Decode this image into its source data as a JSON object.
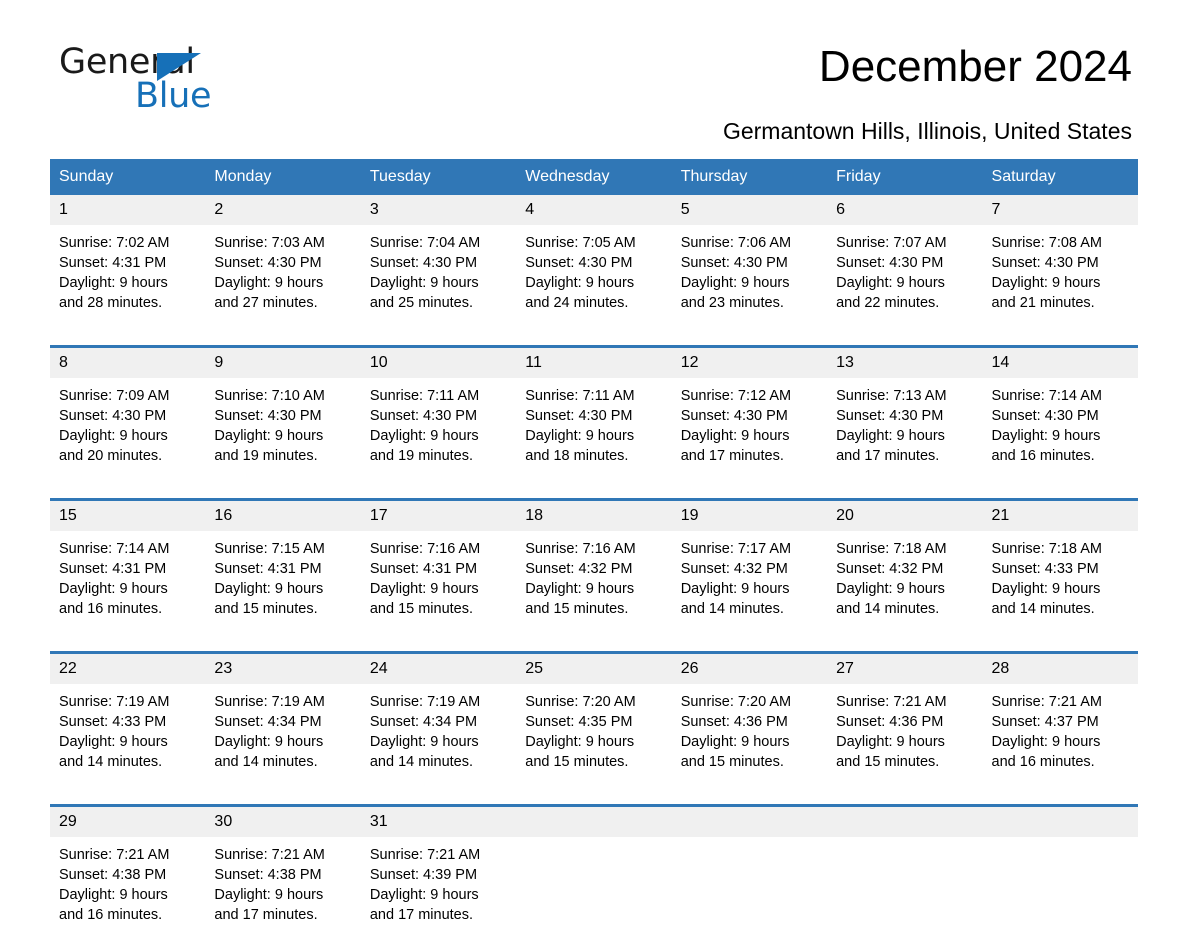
{
  "brand": {
    "name_part1": "General",
    "name_part2": "Blue",
    "accent_color": "#1670b8"
  },
  "header": {
    "title": "December 2024",
    "location": "Germantown Hills, Illinois, United States"
  },
  "calendar": {
    "header_color": "#3077b6",
    "daynum_background": "#f0f0f0",
    "weekdays": [
      "Sunday",
      "Monday",
      "Tuesday",
      "Wednesday",
      "Thursday",
      "Friday",
      "Saturday"
    ],
    "weeks": [
      [
        {
          "day": "1",
          "sunrise": "Sunrise: 7:02 AM",
          "sunset": "Sunset: 4:31 PM",
          "daylight_line1": "Daylight: 9 hours",
          "daylight_line2": "and 28 minutes."
        },
        {
          "day": "2",
          "sunrise": "Sunrise: 7:03 AM",
          "sunset": "Sunset: 4:30 PM",
          "daylight_line1": "Daylight: 9 hours",
          "daylight_line2": "and 27 minutes."
        },
        {
          "day": "3",
          "sunrise": "Sunrise: 7:04 AM",
          "sunset": "Sunset: 4:30 PM",
          "daylight_line1": "Daylight: 9 hours",
          "daylight_line2": "and 25 minutes."
        },
        {
          "day": "4",
          "sunrise": "Sunrise: 7:05 AM",
          "sunset": "Sunset: 4:30 PM",
          "daylight_line1": "Daylight: 9 hours",
          "daylight_line2": "and 24 minutes."
        },
        {
          "day": "5",
          "sunrise": "Sunrise: 7:06 AM",
          "sunset": "Sunset: 4:30 PM",
          "daylight_line1": "Daylight: 9 hours",
          "daylight_line2": "and 23 minutes."
        },
        {
          "day": "6",
          "sunrise": "Sunrise: 7:07 AM",
          "sunset": "Sunset: 4:30 PM",
          "daylight_line1": "Daylight: 9 hours",
          "daylight_line2": "and 22 minutes."
        },
        {
          "day": "7",
          "sunrise": "Sunrise: 7:08 AM",
          "sunset": "Sunset: 4:30 PM",
          "daylight_line1": "Daylight: 9 hours",
          "daylight_line2": "and 21 minutes."
        }
      ],
      [
        {
          "day": "8",
          "sunrise": "Sunrise: 7:09 AM",
          "sunset": "Sunset: 4:30 PM",
          "daylight_line1": "Daylight: 9 hours",
          "daylight_line2": "and 20 minutes."
        },
        {
          "day": "9",
          "sunrise": "Sunrise: 7:10 AM",
          "sunset": "Sunset: 4:30 PM",
          "daylight_line1": "Daylight: 9 hours",
          "daylight_line2": "and 19 minutes."
        },
        {
          "day": "10",
          "sunrise": "Sunrise: 7:11 AM",
          "sunset": "Sunset: 4:30 PM",
          "daylight_line1": "Daylight: 9 hours",
          "daylight_line2": "and 19 minutes."
        },
        {
          "day": "11",
          "sunrise": "Sunrise: 7:11 AM",
          "sunset": "Sunset: 4:30 PM",
          "daylight_line1": "Daylight: 9 hours",
          "daylight_line2": "and 18 minutes."
        },
        {
          "day": "12",
          "sunrise": "Sunrise: 7:12 AM",
          "sunset": "Sunset: 4:30 PM",
          "daylight_line1": "Daylight: 9 hours",
          "daylight_line2": "and 17 minutes."
        },
        {
          "day": "13",
          "sunrise": "Sunrise: 7:13 AM",
          "sunset": "Sunset: 4:30 PM",
          "daylight_line1": "Daylight: 9 hours",
          "daylight_line2": "and 17 minutes."
        },
        {
          "day": "14",
          "sunrise": "Sunrise: 7:14 AM",
          "sunset": "Sunset: 4:30 PM",
          "daylight_line1": "Daylight: 9 hours",
          "daylight_line2": "and 16 minutes."
        }
      ],
      [
        {
          "day": "15",
          "sunrise": "Sunrise: 7:14 AM",
          "sunset": "Sunset: 4:31 PM",
          "daylight_line1": "Daylight: 9 hours",
          "daylight_line2": "and 16 minutes."
        },
        {
          "day": "16",
          "sunrise": "Sunrise: 7:15 AM",
          "sunset": "Sunset: 4:31 PM",
          "daylight_line1": "Daylight: 9 hours",
          "daylight_line2": "and 15 minutes."
        },
        {
          "day": "17",
          "sunrise": "Sunrise: 7:16 AM",
          "sunset": "Sunset: 4:31 PM",
          "daylight_line1": "Daylight: 9 hours",
          "daylight_line2": "and 15 minutes."
        },
        {
          "day": "18",
          "sunrise": "Sunrise: 7:16 AM",
          "sunset": "Sunset: 4:32 PM",
          "daylight_line1": "Daylight: 9 hours",
          "daylight_line2": "and 15 minutes."
        },
        {
          "day": "19",
          "sunrise": "Sunrise: 7:17 AM",
          "sunset": "Sunset: 4:32 PM",
          "daylight_line1": "Daylight: 9 hours",
          "daylight_line2": "and 14 minutes."
        },
        {
          "day": "20",
          "sunrise": "Sunrise: 7:18 AM",
          "sunset": "Sunset: 4:32 PM",
          "daylight_line1": "Daylight: 9 hours",
          "daylight_line2": "and 14 minutes."
        },
        {
          "day": "21",
          "sunrise": "Sunrise: 7:18 AM",
          "sunset": "Sunset: 4:33 PM",
          "daylight_line1": "Daylight: 9 hours",
          "daylight_line2": "and 14 minutes."
        }
      ],
      [
        {
          "day": "22",
          "sunrise": "Sunrise: 7:19 AM",
          "sunset": "Sunset: 4:33 PM",
          "daylight_line1": "Daylight: 9 hours",
          "daylight_line2": "and 14 minutes."
        },
        {
          "day": "23",
          "sunrise": "Sunrise: 7:19 AM",
          "sunset": "Sunset: 4:34 PM",
          "daylight_line1": "Daylight: 9 hours",
          "daylight_line2": "and 14 minutes."
        },
        {
          "day": "24",
          "sunrise": "Sunrise: 7:19 AM",
          "sunset": "Sunset: 4:34 PM",
          "daylight_line1": "Daylight: 9 hours",
          "daylight_line2": "and 14 minutes."
        },
        {
          "day": "25",
          "sunrise": "Sunrise: 7:20 AM",
          "sunset": "Sunset: 4:35 PM",
          "daylight_line1": "Daylight: 9 hours",
          "daylight_line2": "and 15 minutes."
        },
        {
          "day": "26",
          "sunrise": "Sunrise: 7:20 AM",
          "sunset": "Sunset: 4:36 PM",
          "daylight_line1": "Daylight: 9 hours",
          "daylight_line2": "and 15 minutes."
        },
        {
          "day": "27",
          "sunrise": "Sunrise: 7:21 AM",
          "sunset": "Sunset: 4:36 PM",
          "daylight_line1": "Daylight: 9 hours",
          "daylight_line2": "and 15 minutes."
        },
        {
          "day": "28",
          "sunrise": "Sunrise: 7:21 AM",
          "sunset": "Sunset: 4:37 PM",
          "daylight_line1": "Daylight: 9 hours",
          "daylight_line2": "and 16 minutes."
        }
      ],
      [
        {
          "day": "29",
          "sunrise": "Sunrise: 7:21 AM",
          "sunset": "Sunset: 4:38 PM",
          "daylight_line1": "Daylight: 9 hours",
          "daylight_line2": "and 16 minutes."
        },
        {
          "day": "30",
          "sunrise": "Sunrise: 7:21 AM",
          "sunset": "Sunset: 4:38 PM",
          "daylight_line1": "Daylight: 9 hours",
          "daylight_line2": "and 17 minutes."
        },
        {
          "day": "31",
          "sunrise": "Sunrise: 7:21 AM",
          "sunset": "Sunset: 4:39 PM",
          "daylight_line1": "Daylight: 9 hours",
          "daylight_line2": "and 17 minutes."
        },
        {
          "day": "",
          "sunrise": "",
          "sunset": "",
          "daylight_line1": "",
          "daylight_line2": ""
        },
        {
          "day": "",
          "sunrise": "",
          "sunset": "",
          "daylight_line1": "",
          "daylight_line2": ""
        },
        {
          "day": "",
          "sunrise": "",
          "sunset": "",
          "daylight_line1": "",
          "daylight_line2": ""
        },
        {
          "day": "",
          "sunrise": "",
          "sunset": "",
          "daylight_line1": "",
          "daylight_line2": ""
        }
      ]
    ]
  }
}
